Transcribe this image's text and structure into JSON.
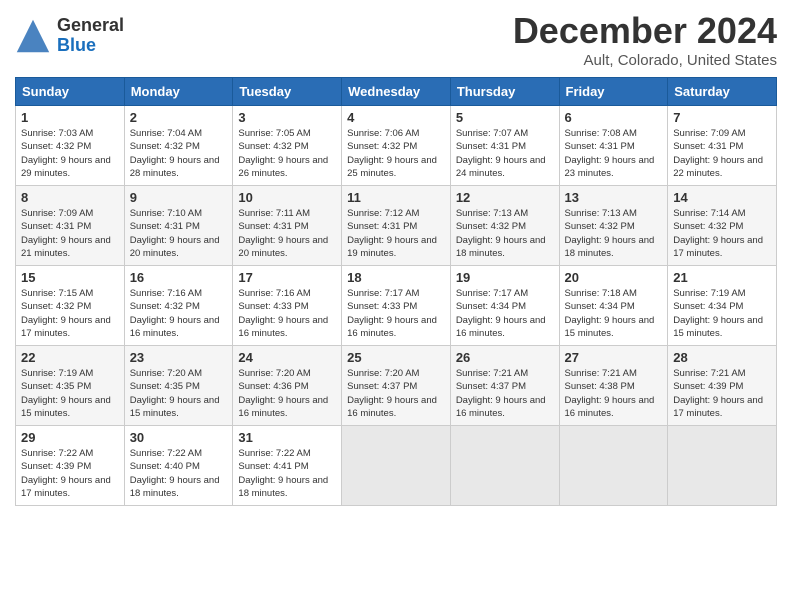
{
  "header": {
    "logo_general": "General",
    "logo_blue": "Blue",
    "month_title": "December 2024",
    "location": "Ault, Colorado, United States"
  },
  "days_of_week": [
    "Sunday",
    "Monday",
    "Tuesday",
    "Wednesday",
    "Thursday",
    "Friday",
    "Saturday"
  ],
  "weeks": [
    [
      {
        "day": "1",
        "sunrise": "7:03 AM",
        "sunset": "4:32 PM",
        "daylight": "9 hours and 29 minutes."
      },
      {
        "day": "2",
        "sunrise": "7:04 AM",
        "sunset": "4:32 PM",
        "daylight": "9 hours and 28 minutes."
      },
      {
        "day": "3",
        "sunrise": "7:05 AM",
        "sunset": "4:32 PM",
        "daylight": "9 hours and 26 minutes."
      },
      {
        "day": "4",
        "sunrise": "7:06 AM",
        "sunset": "4:32 PM",
        "daylight": "9 hours and 25 minutes."
      },
      {
        "day": "5",
        "sunrise": "7:07 AM",
        "sunset": "4:31 PM",
        "daylight": "9 hours and 24 minutes."
      },
      {
        "day": "6",
        "sunrise": "7:08 AM",
        "sunset": "4:31 PM",
        "daylight": "9 hours and 23 minutes."
      },
      {
        "day": "7",
        "sunrise": "7:09 AM",
        "sunset": "4:31 PM",
        "daylight": "9 hours and 22 minutes."
      }
    ],
    [
      {
        "day": "8",
        "sunrise": "7:09 AM",
        "sunset": "4:31 PM",
        "daylight": "9 hours and 21 minutes."
      },
      {
        "day": "9",
        "sunrise": "7:10 AM",
        "sunset": "4:31 PM",
        "daylight": "9 hours and 20 minutes."
      },
      {
        "day": "10",
        "sunrise": "7:11 AM",
        "sunset": "4:31 PM",
        "daylight": "9 hours and 20 minutes."
      },
      {
        "day": "11",
        "sunrise": "7:12 AM",
        "sunset": "4:31 PM",
        "daylight": "9 hours and 19 minutes."
      },
      {
        "day": "12",
        "sunrise": "7:13 AM",
        "sunset": "4:32 PM",
        "daylight": "9 hours and 18 minutes."
      },
      {
        "day": "13",
        "sunrise": "7:13 AM",
        "sunset": "4:32 PM",
        "daylight": "9 hours and 18 minutes."
      },
      {
        "day": "14",
        "sunrise": "7:14 AM",
        "sunset": "4:32 PM",
        "daylight": "9 hours and 17 minutes."
      }
    ],
    [
      {
        "day": "15",
        "sunrise": "7:15 AM",
        "sunset": "4:32 PM",
        "daylight": "9 hours and 17 minutes."
      },
      {
        "day": "16",
        "sunrise": "7:16 AM",
        "sunset": "4:32 PM",
        "daylight": "9 hours and 16 minutes."
      },
      {
        "day": "17",
        "sunrise": "7:16 AM",
        "sunset": "4:33 PM",
        "daylight": "9 hours and 16 minutes."
      },
      {
        "day": "18",
        "sunrise": "7:17 AM",
        "sunset": "4:33 PM",
        "daylight": "9 hours and 16 minutes."
      },
      {
        "day": "19",
        "sunrise": "7:17 AM",
        "sunset": "4:34 PM",
        "daylight": "9 hours and 16 minutes."
      },
      {
        "day": "20",
        "sunrise": "7:18 AM",
        "sunset": "4:34 PM",
        "daylight": "9 hours and 15 minutes."
      },
      {
        "day": "21",
        "sunrise": "7:19 AM",
        "sunset": "4:34 PM",
        "daylight": "9 hours and 15 minutes."
      }
    ],
    [
      {
        "day": "22",
        "sunrise": "7:19 AM",
        "sunset": "4:35 PM",
        "daylight": "9 hours and 15 minutes."
      },
      {
        "day": "23",
        "sunrise": "7:20 AM",
        "sunset": "4:35 PM",
        "daylight": "9 hours and 15 minutes."
      },
      {
        "day": "24",
        "sunrise": "7:20 AM",
        "sunset": "4:36 PM",
        "daylight": "9 hours and 16 minutes."
      },
      {
        "day": "25",
        "sunrise": "7:20 AM",
        "sunset": "4:37 PM",
        "daylight": "9 hours and 16 minutes."
      },
      {
        "day": "26",
        "sunrise": "7:21 AM",
        "sunset": "4:37 PM",
        "daylight": "9 hours and 16 minutes."
      },
      {
        "day": "27",
        "sunrise": "7:21 AM",
        "sunset": "4:38 PM",
        "daylight": "9 hours and 16 minutes."
      },
      {
        "day": "28",
        "sunrise": "7:21 AM",
        "sunset": "4:39 PM",
        "daylight": "9 hours and 17 minutes."
      }
    ],
    [
      {
        "day": "29",
        "sunrise": "7:22 AM",
        "sunset": "4:39 PM",
        "daylight": "9 hours and 17 minutes."
      },
      {
        "day": "30",
        "sunrise": "7:22 AM",
        "sunset": "4:40 PM",
        "daylight": "9 hours and 18 minutes."
      },
      {
        "day": "31",
        "sunrise": "7:22 AM",
        "sunset": "4:41 PM",
        "daylight": "9 hours and 18 minutes."
      },
      null,
      null,
      null,
      null
    ]
  ]
}
